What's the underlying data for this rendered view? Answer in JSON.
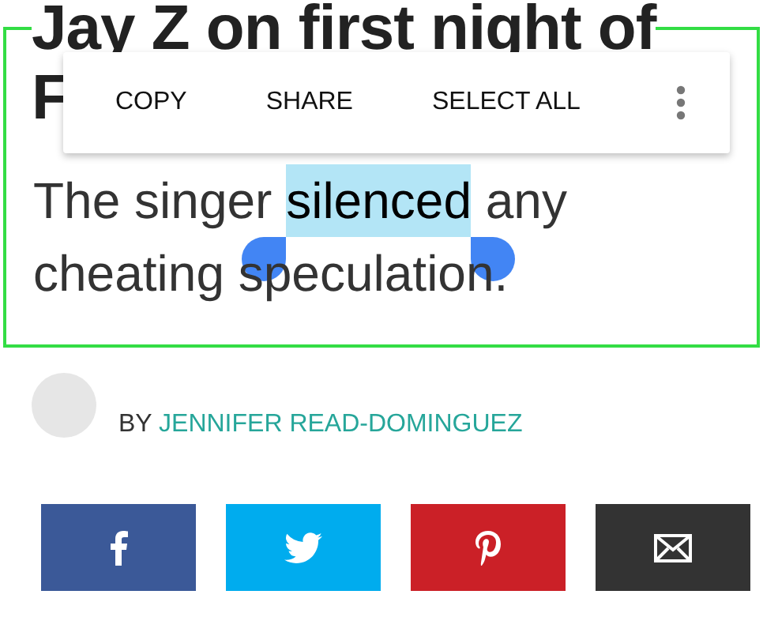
{
  "headline_lines": [
    "Jay Z on first night of",
    "F"
  ],
  "text_menu": {
    "actions": [
      "COPY",
      "SHARE",
      "SELECT ALL"
    ]
  },
  "excerpt": {
    "segments": [
      {
        "text": "The singer ",
        "selected": false
      },
      {
        "text": "silenced",
        "selected": true
      },
      {
        "text": " any cheating speculation.",
        "selected": false
      }
    ]
  },
  "byline": {
    "prefix": "BY",
    "author": "JENNIFER READ-DOMINGUEZ"
  },
  "share_buttons": [
    {
      "kind": "facebook",
      "color": "#3b5998"
    },
    {
      "kind": "twitter",
      "color": "#00acee"
    },
    {
      "kind": "pinterest",
      "color": "#cb2027"
    },
    {
      "kind": "email",
      "color": "#333333"
    }
  ]
}
